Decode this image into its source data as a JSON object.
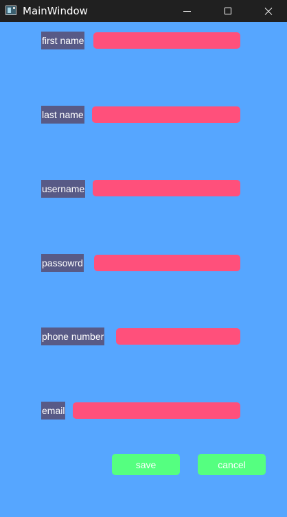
{
  "window": {
    "title": "MainWindow",
    "icon": "app-window-icon",
    "controls": [
      "minimize-icon",
      "maximize-icon",
      "close-icon"
    ]
  },
  "form": {
    "fields": [
      {
        "label": "first name",
        "value": ""
      },
      {
        "label": "last name",
        "value": ""
      },
      {
        "label": "username",
        "value": ""
      },
      {
        "label": "passowrd",
        "value": ""
      },
      {
        "label": "phone number",
        "value": ""
      },
      {
        "label": "email",
        "value": ""
      }
    ],
    "save_label": "save",
    "cancel_label": "cancel"
  },
  "colors": {
    "background": "#56a6ff",
    "label_bg": "#585a86",
    "input_bg": "#ff507b",
    "button_bg": "#55ff80",
    "titlebar_bg": "#202020"
  }
}
